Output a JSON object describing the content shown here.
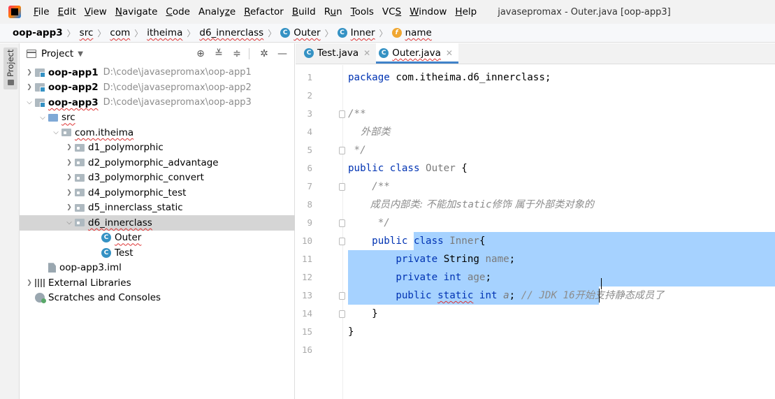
{
  "menubar": {
    "items": [
      {
        "label": "File",
        "mnemonic": "F"
      },
      {
        "label": "Edit",
        "mnemonic": "E"
      },
      {
        "label": "View",
        "mnemonic": "V"
      },
      {
        "label": "Navigate",
        "mnemonic": "N"
      },
      {
        "label": "Code",
        "mnemonic": "C"
      },
      {
        "label": "Analyze",
        "mnemonic": "z"
      },
      {
        "label": "Refactor",
        "mnemonic": "R"
      },
      {
        "label": "Build",
        "mnemonic": "B"
      },
      {
        "label": "Run",
        "mnemonic": "u"
      },
      {
        "label": "Tools",
        "mnemonic": "T"
      },
      {
        "label": "VCS",
        "mnemonic": "S"
      },
      {
        "label": "Window",
        "mnemonic": "W"
      },
      {
        "label": "Help",
        "mnemonic": "H"
      }
    ],
    "window_title": "javasepromax - Outer.java [oop-app3]"
  },
  "breadcrumb": {
    "items": [
      {
        "label": "oop-app3",
        "icon": "none"
      },
      {
        "label": "src",
        "icon": "none"
      },
      {
        "label": "com",
        "icon": "none"
      },
      {
        "label": "itheima",
        "icon": "none"
      },
      {
        "label": "d6_innerclass",
        "icon": "none"
      },
      {
        "label": "Outer",
        "icon": "class-icon"
      },
      {
        "label": "Inner",
        "icon": "class-icon"
      },
      {
        "label": "name",
        "icon": "field-icon"
      }
    ]
  },
  "side_strip": {
    "tab_label": "Project"
  },
  "project_panel": {
    "title": "Project",
    "tools": [
      "locate-icon",
      "expand-all-icon",
      "collapse-all-icon",
      "gear-icon",
      "minimize-icon"
    ],
    "tree": [
      {
        "label": "oop-app1",
        "path": "D:\\code\\javasepromax\\oop-app1",
        "depth": 0,
        "arrow": "›",
        "icon": "module",
        "bold": true
      },
      {
        "label": "oop-app2",
        "path": "D:\\code\\javasepromax\\oop-app2",
        "depth": 0,
        "arrow": "›",
        "icon": "module",
        "bold": true
      },
      {
        "label": "oop-app3",
        "path": "D:\\code\\javasepromax\\oop-app3",
        "depth": 0,
        "arrow": "⌄",
        "icon": "module",
        "bold": true
      },
      {
        "label": "src",
        "path": "",
        "depth": 1,
        "arrow": "⌄",
        "icon": "src-folder",
        "bold": false
      },
      {
        "label": "com.itheima",
        "path": "",
        "depth": 2,
        "arrow": "⌄",
        "icon": "package",
        "bold": false
      },
      {
        "label": "d1_polymorphic",
        "path": "",
        "depth": 3,
        "arrow": "›",
        "icon": "package",
        "bold": false
      },
      {
        "label": "d2_polymorphic_advantage",
        "path": "",
        "depth": 3,
        "arrow": "›",
        "icon": "package",
        "bold": false
      },
      {
        "label": "d3_polymorphic_convert",
        "path": "",
        "depth": 3,
        "arrow": "›",
        "icon": "package",
        "bold": false
      },
      {
        "label": "d4_polymorphic_test",
        "path": "",
        "depth": 3,
        "arrow": "›",
        "icon": "package",
        "bold": false
      },
      {
        "label": "d5_innerclass_static",
        "path": "",
        "depth": 3,
        "arrow": "›",
        "icon": "package",
        "bold": false
      },
      {
        "label": "d6_innerclass",
        "path": "",
        "depth": 3,
        "arrow": "⌄",
        "icon": "package",
        "bold": false,
        "selected": true
      },
      {
        "label": "Outer",
        "path": "",
        "depth": 5,
        "arrow": "",
        "icon": "class",
        "bold": false
      },
      {
        "label": "Test",
        "path": "",
        "depth": 5,
        "arrow": "",
        "icon": "class",
        "bold": false
      },
      {
        "label": "oop-app3.iml",
        "path": "",
        "depth": 1,
        "arrow": "",
        "icon": "iml",
        "bold": false
      },
      {
        "label": "External Libraries",
        "path": "",
        "depth": 0,
        "arrow": "›",
        "icon": "library",
        "bold": false
      },
      {
        "label": "Scratches and Consoles",
        "path": "",
        "depth": 0,
        "arrow": "",
        "icon": "scratch",
        "bold": false
      }
    ]
  },
  "editor": {
    "tabs": [
      {
        "label": "Test.java",
        "active": false
      },
      {
        "label": "Outer.java",
        "active": true
      }
    ],
    "line_numbers": [
      "1",
      "2",
      "3",
      "4",
      "5",
      "6",
      "7",
      "8",
      "9",
      "10",
      "11",
      "12",
      "13",
      "14",
      "15",
      "16"
    ],
    "lines": [
      [
        {
          "t": "package ",
          "c": "kw"
        },
        {
          "t": "com.itheima.d6_innerclass;",
          "c": ""
        }
      ],
      [],
      [
        {
          "t": "/**",
          "c": "com"
        }
      ],
      [
        {
          "t": "    外部类",
          "c": "com cjk"
        }
      ],
      [
        {
          "t": " */",
          "c": "com"
        }
      ],
      [
        {
          "t": "public class ",
          "c": "kw"
        },
        {
          "t": "Outer",
          "c": "unused"
        },
        {
          "t": " {",
          "c": ""
        }
      ],
      [
        {
          "t": "    /**",
          "c": "com"
        }
      ],
      [
        {
          "t": "       成员内部类: 不能加",
          "c": "com cjk"
        },
        {
          "t": "static",
          "c": "com"
        },
        {
          "t": "修饰 属于外部类对象的",
          "c": "com cjk"
        }
      ],
      [
        {
          "t": "     */",
          "c": "com"
        }
      ],
      [
        {
          "t": "    ",
          "c": ""
        },
        {
          "t": "public class ",
          "c": "kw"
        },
        {
          "t": "Inner",
          "c": "unused"
        },
        {
          "t": "{",
          "c": ""
        }
      ],
      [
        {
          "t": "        ",
          "c": ""
        },
        {
          "t": "private ",
          "c": "kw"
        },
        {
          "t": "String ",
          "c": ""
        },
        {
          "t": "name",
          "c": "unused"
        },
        {
          "t": ";",
          "c": ""
        }
      ],
      [
        {
          "t": "        ",
          "c": ""
        },
        {
          "t": "private int ",
          "c": "kw"
        },
        {
          "t": "age",
          "c": "unused"
        },
        {
          "t": ";",
          "c": ""
        }
      ],
      [
        {
          "t": "        ",
          "c": ""
        },
        {
          "t": "public ",
          "c": "kw"
        },
        {
          "t": "static",
          "c": "kw wavy"
        },
        {
          "t": " int ",
          "c": "kw"
        },
        {
          "t": "a",
          "c": "unused fld-static"
        },
        {
          "t": "; ",
          "c": ""
        },
        {
          "t": "// JDK 16",
          "c": "com"
        },
        {
          "t": "开始支持静态成员了",
          "c": "com cjk"
        }
      ],
      [
        {
          "t": "    }",
          "c": ""
        }
      ],
      [
        {
          "t": "}",
          "c": ""
        }
      ],
      []
    ]
  },
  "colors": {
    "keyword": "#0033b3",
    "comment": "#8c8c8c",
    "selection": "#a6d2ff",
    "active_tab_underline": "#4083c9",
    "class_icon": "#3592c4",
    "field_icon": "#f0a732"
  }
}
